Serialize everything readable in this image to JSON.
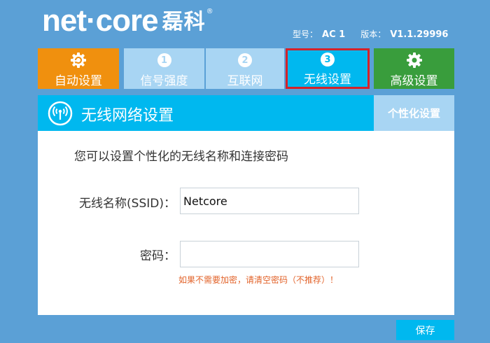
{
  "brand": {
    "name": "net·core",
    "chinese": "磊科",
    "registered": "®"
  },
  "version_info": {
    "model_label": "型号：",
    "model_value": "AC 1",
    "version_label": "版本：",
    "version_value": "V1.1.29996"
  },
  "tabs": [
    {
      "label": "自动设置",
      "icon": "gear-refresh-icon"
    },
    {
      "label": "信号强度",
      "number": "1"
    },
    {
      "label": "互联网",
      "number": "2"
    },
    {
      "label": "无线设置",
      "number": "3",
      "active": true
    },
    {
      "label": "高级设置",
      "icon": "gear-icon"
    }
  ],
  "panel": {
    "title": "无线网络设置",
    "side_tab": "个性化设置",
    "intro": "您可以设置个性化的无线名称和连接密码",
    "ssid_label": "无线名称(SSID)：",
    "ssid_value": "Netcore",
    "password_label": "密码：",
    "password_value": "",
    "password_hint": "如果不需要加密，请清空密码（不推荐）！"
  },
  "actions": {
    "save_label": "保存"
  },
  "colors": {
    "background": "#5ba0d6",
    "accent_blue": "#00b8ef",
    "auto_orange": "#f0900e",
    "advanced_green": "#399d3c",
    "inactive_tab": "#a8d5f3",
    "highlight_red": "#d4222a",
    "hint_orange": "#e2632a"
  }
}
